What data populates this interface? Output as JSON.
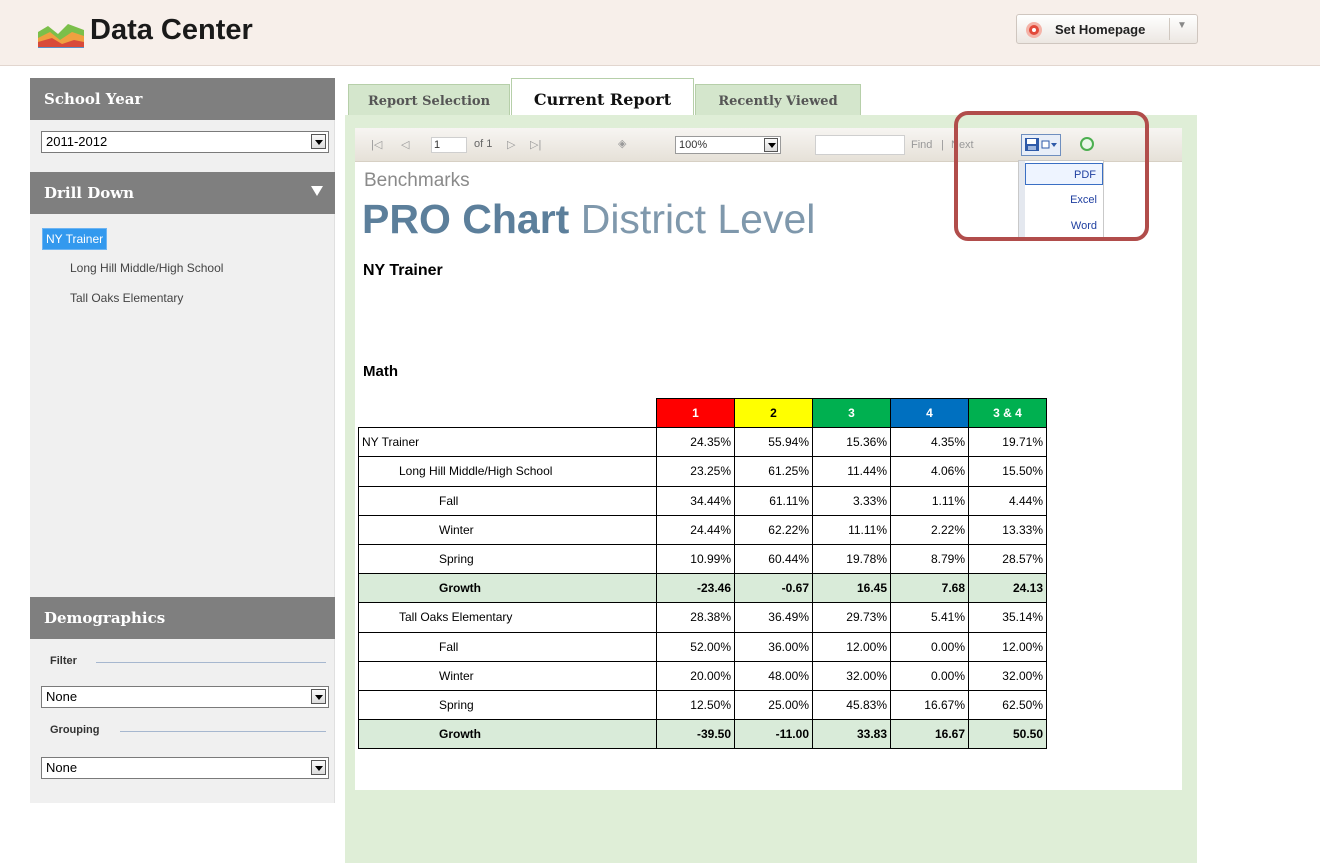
{
  "header": {
    "app_title": "Data Center",
    "set_homepage_label": "Set Homepage"
  },
  "sidebar": {
    "school_year": {
      "title": "School Year",
      "selected": "2011-2012"
    },
    "drill_down": {
      "title": "Drill Down",
      "items": [
        "NY Trainer",
        "Long Hill Middle/High School",
        "Tall Oaks Elementary"
      ]
    },
    "demographics": {
      "title": "Demographics",
      "filter_label": "Filter",
      "filter_value": "None",
      "grouping_label": "Grouping",
      "grouping_value": "None"
    }
  },
  "tabs": [
    "Report Selection",
    "Current Report",
    "Recently Viewed"
  ],
  "toolbar": {
    "page_value": "1",
    "page_of": "of 1",
    "zoom": "100%",
    "find_label": "Find",
    "find_separator": "|",
    "next_label": "Next"
  },
  "export_menu": [
    "PDF",
    "Excel",
    "Word"
  ],
  "report": {
    "subtitle": "Benchmarks",
    "title_bold": "PRO Chart",
    "title_rest": " District Level",
    "org": "NY Trainer",
    "subject": "Math",
    "level_headers": [
      "1",
      "2",
      "3",
      "4",
      "3 & 4"
    ],
    "level_colors": [
      "#ff0000",
      "#ffff00",
      "#00b050",
      "#0070c0",
      "#00b050"
    ],
    "rows": [
      {
        "name": "NY Trainer",
        "indent": 0,
        "values": [
          "24.35%",
          "55.94%",
          "15.36%",
          "4.35%",
          "19.71%"
        ]
      },
      {
        "name": "Long Hill Middle/High School",
        "indent": 1,
        "values": [
          "23.25%",
          "61.25%",
          "11.44%",
          "4.06%",
          "15.50%"
        ]
      },
      {
        "name": "Fall",
        "indent": 2,
        "values": [
          "34.44%",
          "61.11%",
          "3.33%",
          "1.11%",
          "4.44%"
        ]
      },
      {
        "name": "Winter",
        "indent": 2,
        "values": [
          "24.44%",
          "62.22%",
          "11.11%",
          "2.22%",
          "13.33%"
        ]
      },
      {
        "name": "Spring",
        "indent": 2,
        "values": [
          "10.99%",
          "60.44%",
          "19.78%",
          "8.79%",
          "28.57%"
        ]
      },
      {
        "name": "Growth",
        "indent": 2,
        "growth": true,
        "values": [
          "-23.46",
          "-0.67",
          "16.45",
          "7.68",
          "24.13"
        ]
      },
      {
        "name": "Tall Oaks Elementary",
        "indent": 1,
        "values": [
          "28.38%",
          "36.49%",
          "29.73%",
          "5.41%",
          "35.14%"
        ]
      },
      {
        "name": "Fall",
        "indent": 2,
        "values": [
          "52.00%",
          "36.00%",
          "12.00%",
          "0.00%",
          "12.00%"
        ]
      },
      {
        "name": "Winter",
        "indent": 2,
        "values": [
          "20.00%",
          "48.00%",
          "32.00%",
          "0.00%",
          "32.00%"
        ]
      },
      {
        "name": "Spring",
        "indent": 2,
        "values": [
          "12.50%",
          "25.00%",
          "45.83%",
          "16.67%",
          "62.50%"
        ]
      },
      {
        "name": "Growth",
        "indent": 2,
        "growth": true,
        "values": [
          "-39.50",
          "-11.00",
          "33.83",
          "16.67",
          "50.50"
        ]
      }
    ]
  }
}
